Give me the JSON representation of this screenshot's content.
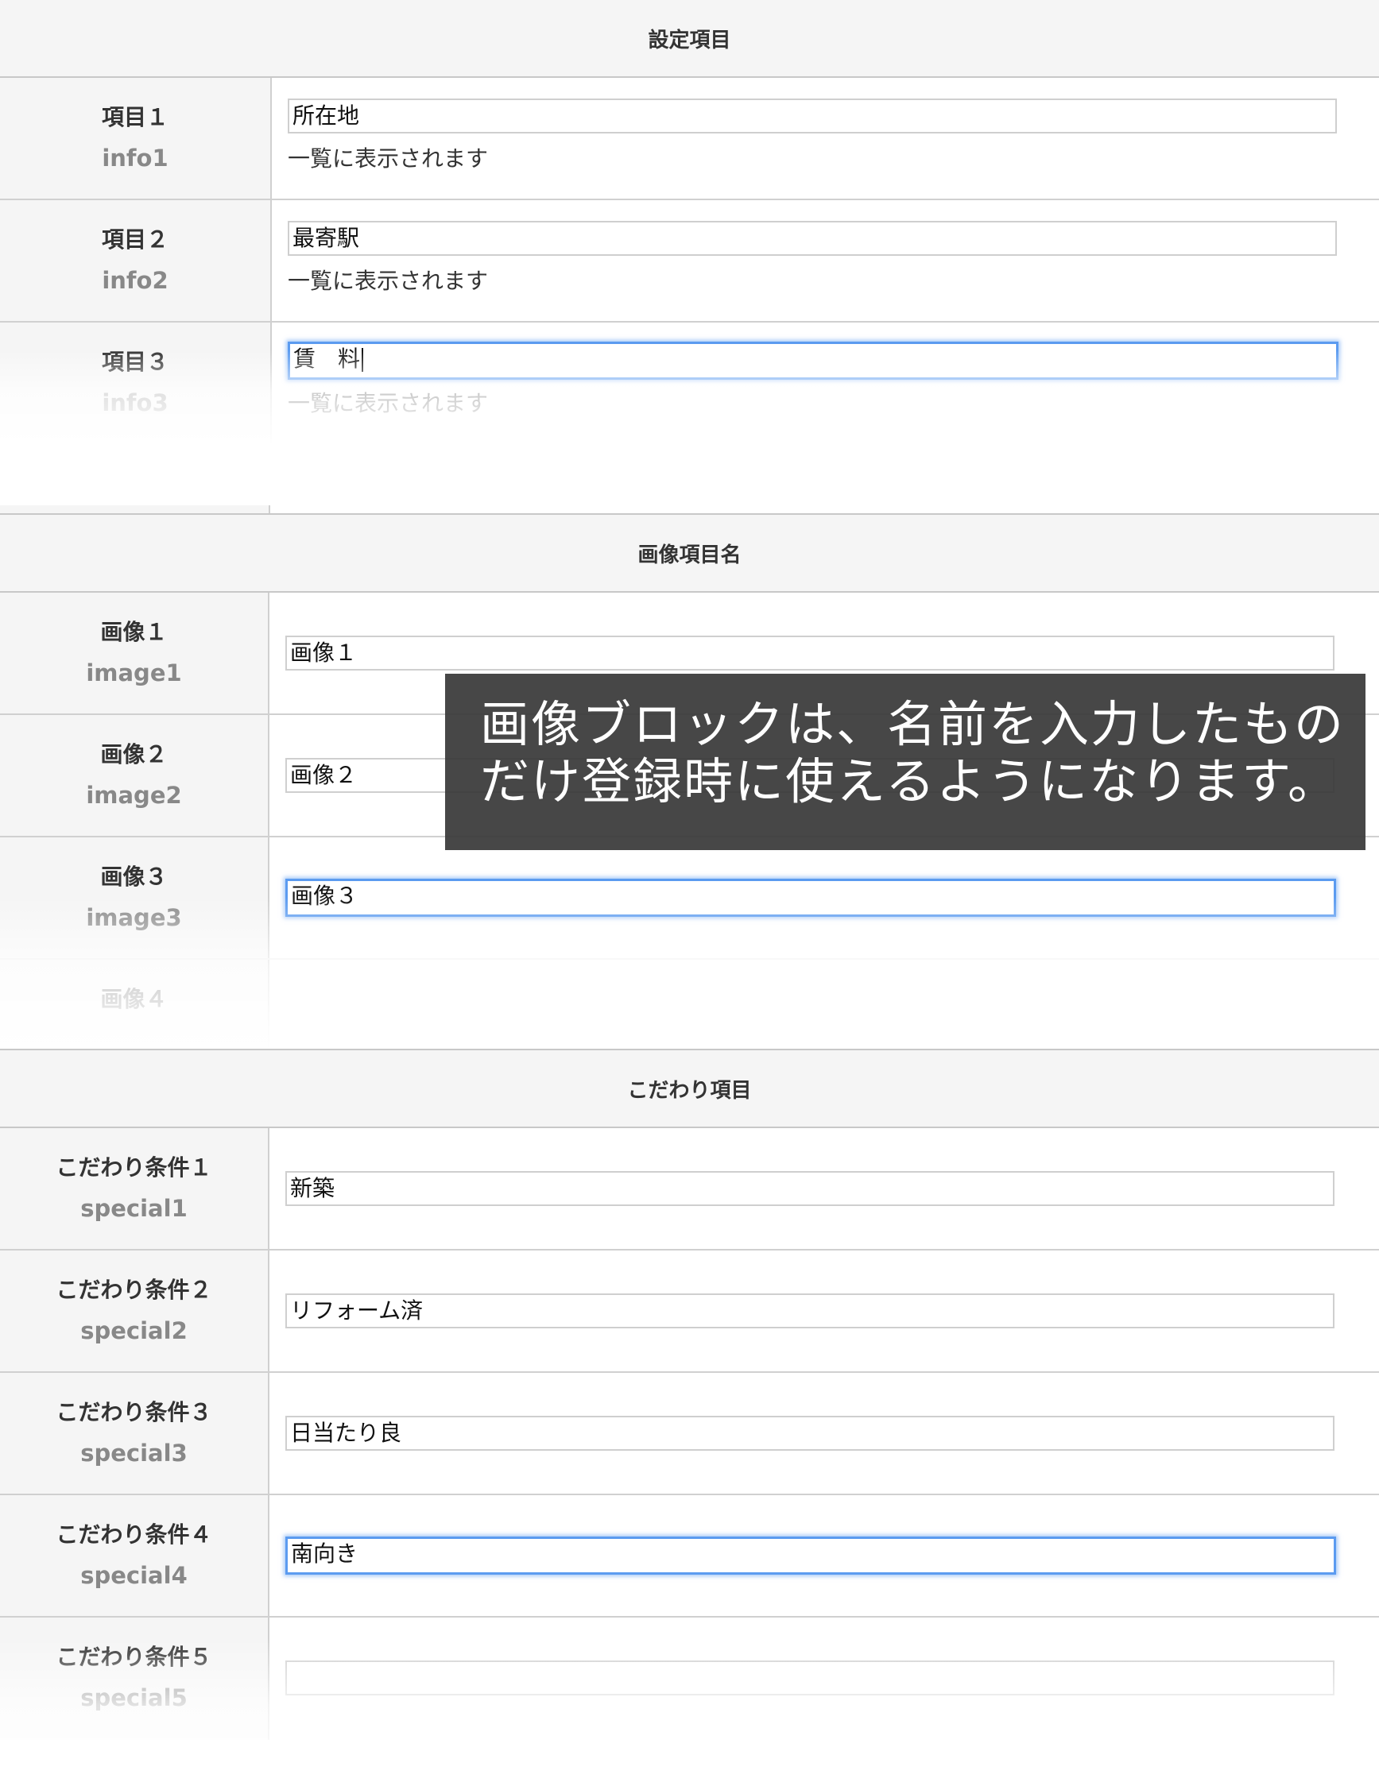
{
  "settings": {
    "header": "設定項目",
    "rows": [
      {
        "label": "項目１",
        "key": "info1",
        "value": "所在地",
        "help": "一覧に表示されます"
      },
      {
        "label": "項目２",
        "key": "info2",
        "value": "最寄駅",
        "help": "一覧に表示されます"
      },
      {
        "label": "項目３",
        "key": "info3",
        "value": "賃　料",
        "help": "一覧に表示されます"
      }
    ]
  },
  "images": {
    "header": "画像項目名",
    "rows": [
      {
        "label": "画像１",
        "key": "image1",
        "value": "画像１"
      },
      {
        "label": "画像２",
        "key": "image2",
        "value": "画像２"
      },
      {
        "label": "画像３",
        "key": "image3",
        "value": "画像３"
      },
      {
        "label": "画像４",
        "key": "",
        "value": ""
      }
    ]
  },
  "special": {
    "header": "こだわり項目",
    "rows": [
      {
        "label": "こだわり条件１",
        "key": "special1",
        "value": "新築"
      },
      {
        "label": "こだわり条件２",
        "key": "special2",
        "value": "リフォーム済"
      },
      {
        "label": "こだわり条件３",
        "key": "special3",
        "value": "日当たり良"
      },
      {
        "label": "こだわり条件４",
        "key": "special4",
        "value": "南向き"
      },
      {
        "label": "こだわり条件５",
        "key": "special5",
        "value": ""
      }
    ]
  },
  "overlay": {
    "line1": "画像ブロックは、名前を入力したもの",
    "line2": "だけ登録時に使えるようになります。"
  },
  "colors": {
    "focus_border": "#5b9bf0",
    "overlay_bg": "#373737",
    "label_bg": "#f5f5f5"
  }
}
